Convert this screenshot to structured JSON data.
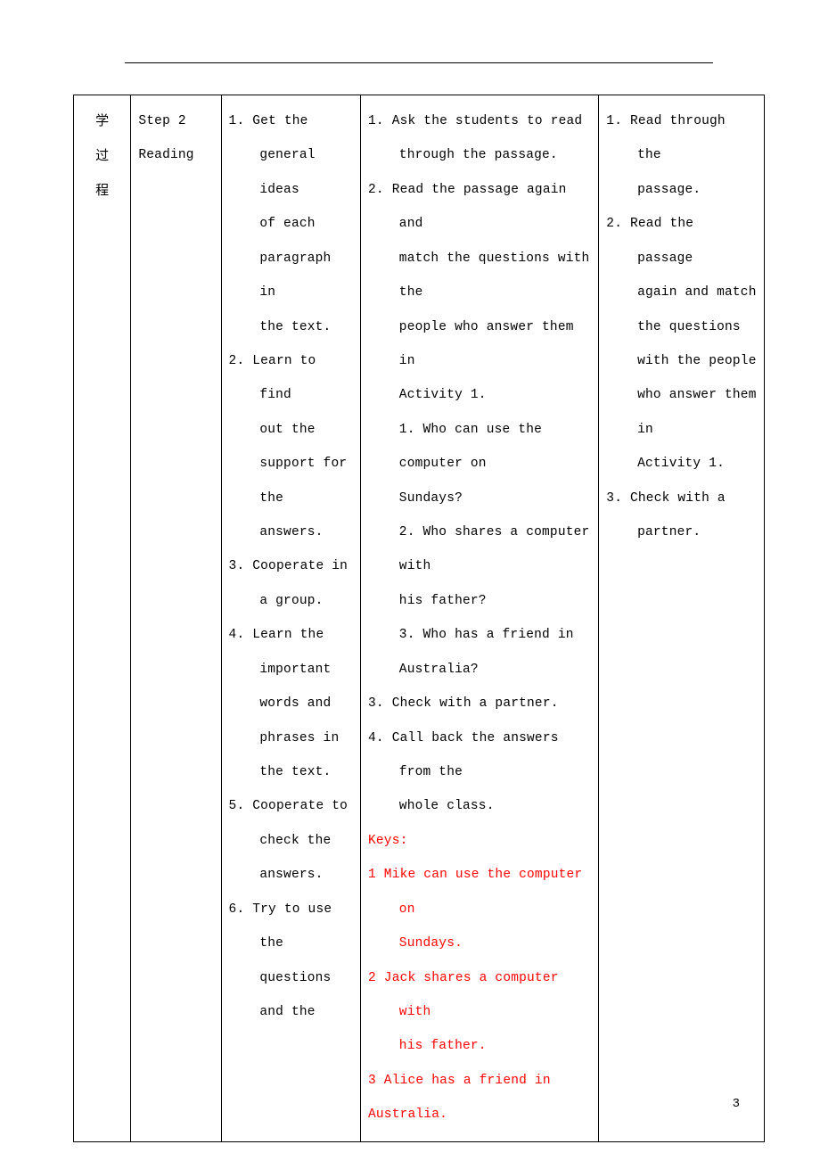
{
  "page_number": "3",
  "row_label_chars": [
    "学",
    "过",
    "程"
  ],
  "col_b": {
    "step_no": "Step 2",
    "step_title": "Reading"
  },
  "col_c": {
    "i1": "1. Get the",
    "i1b": "general ideas",
    "i1c": "of each",
    "i1d": "paragraph in",
    "i1e": "the text.",
    "i2": "2. Learn to find",
    "i2b": "out the",
    "i2c": "support for",
    "i2d": "the answers.",
    "i3": "3. Cooperate in",
    "i3b": "a group.",
    "i4": "4. Learn the",
    "i4b": "important",
    "i4c": "words and",
    "i4d": "phrases in",
    "i4e": "the text.",
    "i5": "5. Cooperate to",
    "i5b": "check the",
    "i5c": "answers.",
    "i6": "6. Try to use",
    "i6b": "the questions",
    "i6c": "and the"
  },
  "col_d": {
    "d1": "1. Ask the students to read",
    "d1b": "through the passage.",
    "d2": "2. Read the passage again and",
    "d2b": "match the questions with the",
    "d2c": "people who answer them in",
    "d2d": "Activity 1.",
    "d2q1": "1. Who can use the computer on",
    "d2q1b": "Sundays?",
    "d2q2": "2. Who shares a computer with",
    "d2q2b": "his father?",
    "d2q3": "3. Who has a friend in",
    "d2q3b": "Australia?",
    "d3": "3. Check with a partner.",
    "d4": "4. Call back the answers from the",
    "d4b": "whole class.",
    "keys_label": "Keys:",
    "k1": "1 Mike can use the computer on",
    "k1b": "Sundays.",
    "k2": "2 Jack shares a computer with",
    "k2b": "his father.",
    "k3": "3 Alice has a friend in",
    "k3b": "Australia."
  },
  "col_e": {
    "e1": "1. Read through the",
    "e1b": "passage.",
    "e2": "2. Read the passage",
    "e2b": "again and match",
    "e2c": "the questions",
    "e2d": "with the people",
    "e2e": "who answer them in",
    "e2f": "Activity 1.",
    "e3": "3. Check with a",
    "e3b": "partner."
  }
}
